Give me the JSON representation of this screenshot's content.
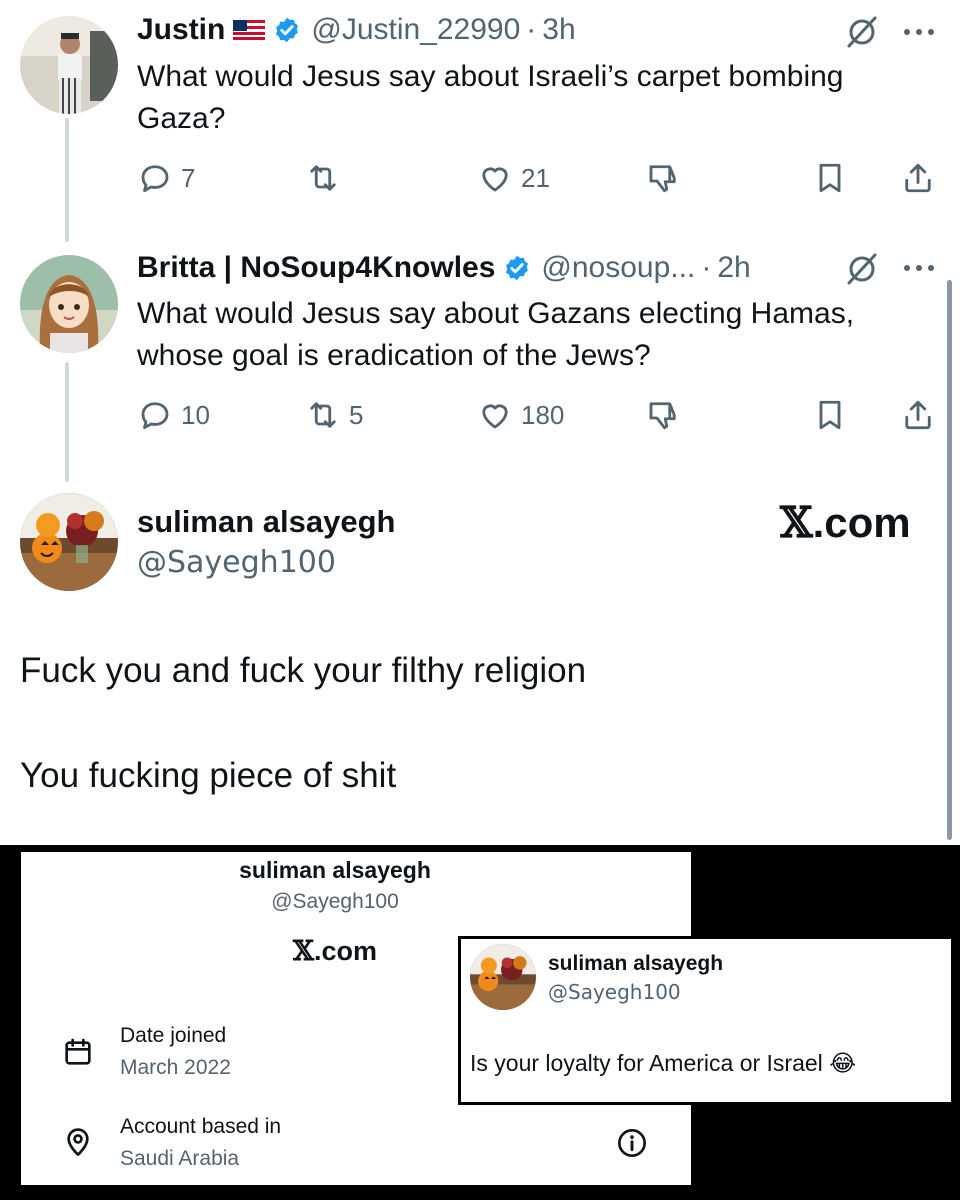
{
  "thread": [
    {
      "name": "Justin",
      "handle": "@Justin_22990",
      "separator": "·",
      "time": "3h",
      "text": "What would Jesus say about Israeli’s carpet bombing Gaza?",
      "replies": "7",
      "reposts": "",
      "likes": "21"
    },
    {
      "name": "Britta | NoSoup4Knowles",
      "handle": "@nosoup...",
      "separator": "·",
      "time": "2h",
      "text": "What would Jesus say about Gazans electing Hamas, whose goal is eradication of the Jews?",
      "replies": "10",
      "reposts": "5",
      "likes": "180"
    }
  ],
  "main_tweet": {
    "name": "suliman alsayegh",
    "handle": "@Sayegh100",
    "brand_x": "𝕏",
    "brand_suffix": ".com",
    "lines": [
      "Fuck you and fuck your filthy religion",
      "You fucking piece of shit"
    ]
  },
  "profile_panel": {
    "name": "suliman alsayegh",
    "handle": "@Sayegh100",
    "brand_x": "𝕏",
    "brand_suffix": ".com",
    "date_joined_label": "Date joined",
    "date_joined_value": "March 2022",
    "based_in_label": "Account based in",
    "based_in_value": "Saudi Arabia"
  },
  "inset_tweet": {
    "name": "suliman alsayegh",
    "handle": "@Sayegh100",
    "text": "Is your loyalty for America or Israel",
    "emoji": "😂"
  },
  "icons": {
    "reply": "reply-icon",
    "repost": "repost-icon",
    "like": "heart-icon",
    "dislike": "thumbs-down-icon",
    "bookmark": "bookmark-icon",
    "share": "share-icon",
    "grok": "grok-icon",
    "more": "more-icon",
    "calendar": "calendar-icon",
    "location": "location-pin-icon",
    "info": "info-icon"
  },
  "colors": {
    "verified": "#1d9bf0",
    "secondary_text": "#536471",
    "thread_line": "#cfd9de"
  }
}
